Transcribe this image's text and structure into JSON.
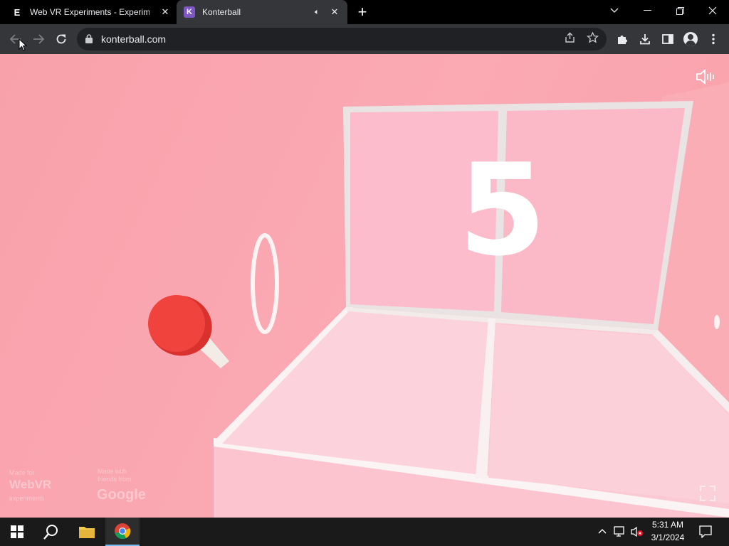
{
  "browser": {
    "tabs": [
      {
        "title": "Web VR Experiments - Experiments with Google",
        "favicon": "E",
        "active": false
      },
      {
        "title": "Konterball",
        "favicon": "K",
        "active": true,
        "audio": true
      }
    ],
    "new_tab_label": "+",
    "address": "konterball.com"
  },
  "game": {
    "score": "5",
    "credits": {
      "webvr_line1": "Made for",
      "webvr_brand": "WebVR",
      "webvr_line2": "experiments",
      "google_line1": "Made with",
      "google_line2": "friends from",
      "google_brand": "Google"
    },
    "colors": {
      "background": "#f9a5ae",
      "paddle": "#f0433d",
      "table": "#fbd3da"
    }
  },
  "taskbar": {
    "time": "5:31 AM",
    "date": "3/1/2024"
  },
  "colors": {
    "tab_active": "#35363a",
    "omnibox": "#202124",
    "taskbar": "#1a1a1a"
  }
}
